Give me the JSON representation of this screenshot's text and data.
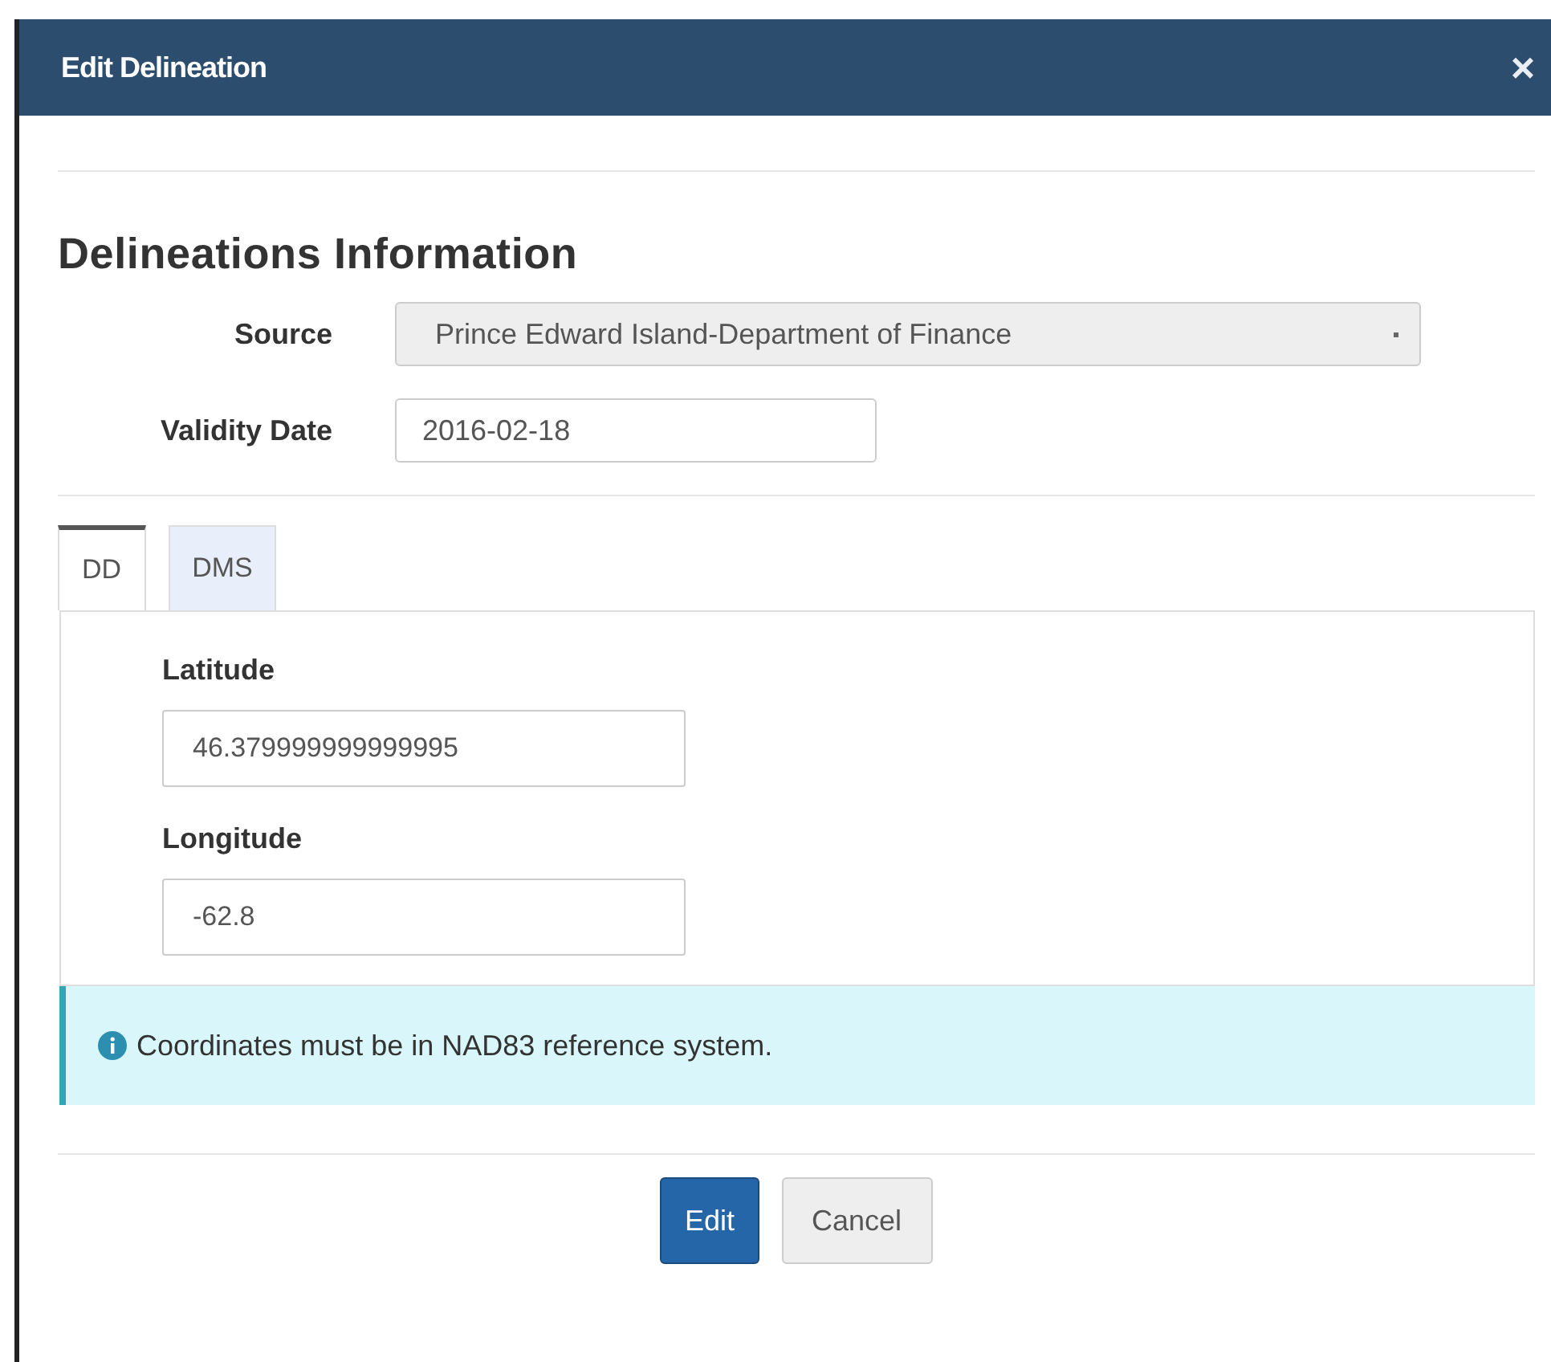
{
  "window": {
    "title": "Edit Delineation",
    "close": "×"
  },
  "heading": "Delineations Information",
  "fields": [
    {
      "kind": "select",
      "label": "Source",
      "value": "Prince Edward Island-Department of Finance",
      "disabled": true
    },
    {
      "kind": "text",
      "label": "Validity Date",
      "value": "2016-02-18",
      "disabled": false
    }
  ],
  "tabs": [
    {
      "label": "DD",
      "selected": true
    },
    {
      "label": "DMS",
      "selected": false
    }
  ],
  "coordinates": [
    {
      "label": "Latitude",
      "value": "46.379999999999995"
    },
    {
      "label": "Longitude",
      "value": "-62.8"
    }
  ],
  "info": {
    "text": "Coordinates must be in NAD83 reference system."
  },
  "buttons": [
    {
      "label": "Edit",
      "kind": "primary"
    },
    {
      "label": "Cancel",
      "kind": "default"
    }
  ]
}
